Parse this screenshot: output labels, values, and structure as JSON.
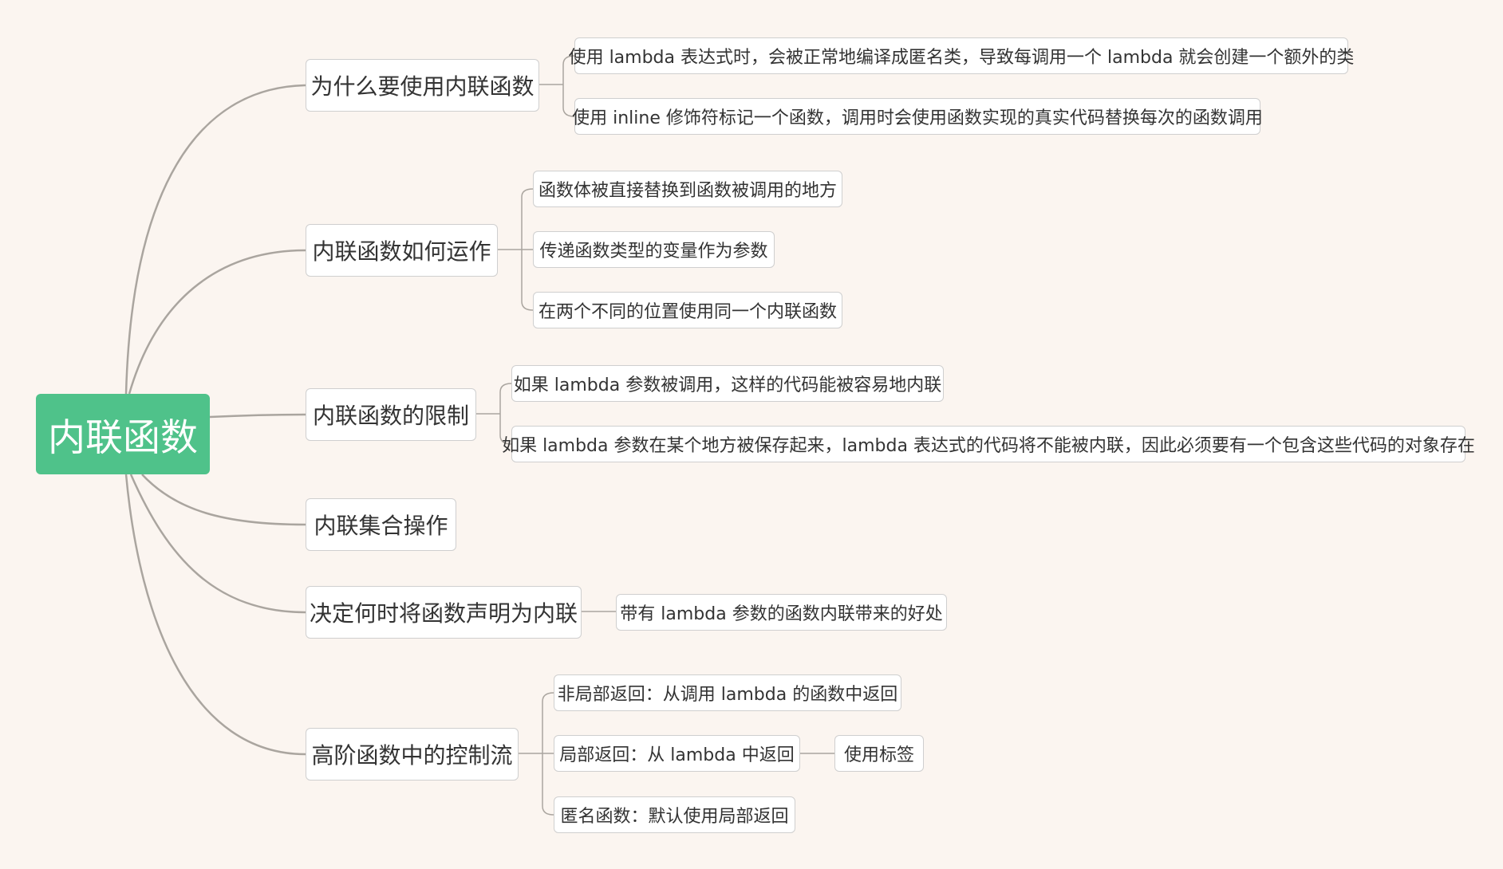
{
  "root": {
    "label": "内联函数"
  },
  "branches": [
    {
      "label": "为什么要使用内联函数",
      "children": [
        {
          "label": "使用 lambda 表达式时，会被正常地编译成匿名类，导致每调用一个 lambda 就会创建一个额外的类"
        },
        {
          "label": "使用 inline 修饰符标记一个函数，调用时会使用函数实现的真实代码替换每次的函数调用"
        }
      ]
    },
    {
      "label": "内联函数如何运作",
      "children": [
        {
          "label": "函数体被直接替换到函数被调用的地方"
        },
        {
          "label": "传递函数类型的变量作为参数"
        },
        {
          "label": "在两个不同的位置使用同一个内联函数"
        }
      ]
    },
    {
      "label": "内联函数的限制",
      "children": [
        {
          "label": "如果 lambda 参数被调用，这样的代码能被容易地内联"
        },
        {
          "label": "如果 lambda 参数在某个地方被保存起来，lambda 表达式的代码将不能被内联，因此必须要有一个包含这些代码的对象存在"
        }
      ]
    },
    {
      "label": "内联集合操作",
      "children": []
    },
    {
      "label": "决定何时将函数声明为内联",
      "children": [
        {
          "label": "带有 lambda 参数的函数内联带来的好处"
        }
      ]
    },
    {
      "label": "高阶函数中的控制流",
      "children": [
        {
          "label": "非局部返回：从调用 lambda 的函数中返回"
        },
        {
          "label": "局部返回：从 lambda 中返回",
          "child": {
            "label": "使用标签"
          }
        },
        {
          "label": "匿名函数：默认使用局部返回"
        }
      ]
    }
  ]
}
